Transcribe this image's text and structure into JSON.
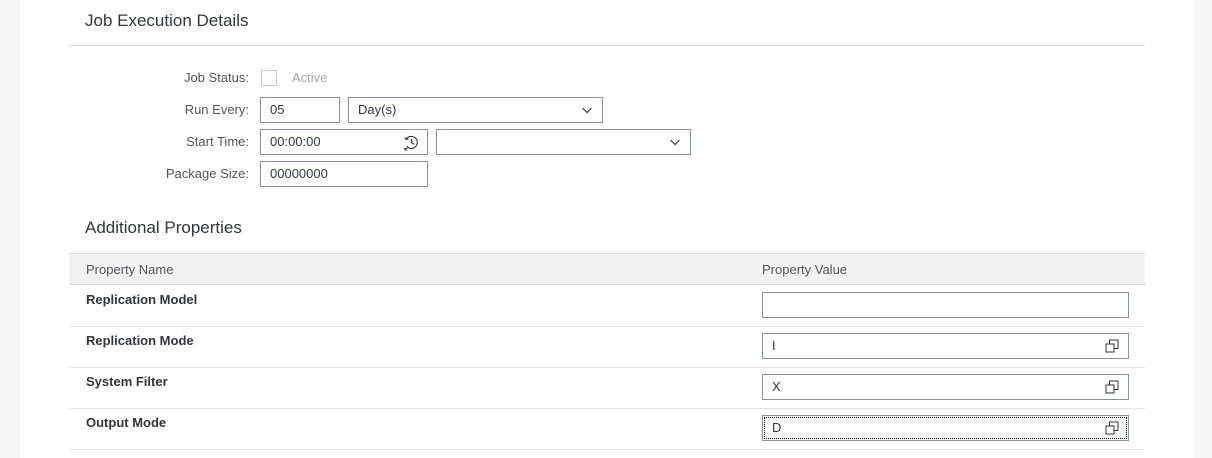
{
  "job_execution": {
    "title": "Job Execution Details",
    "job_status": {
      "label": "Job Status:",
      "checkbox_label": "Active",
      "checked": false
    },
    "run_every": {
      "label": "Run Every:",
      "value": "05",
      "unit": "Day(s)"
    },
    "start_time": {
      "label": "Start Time:",
      "value": "00:00:00",
      "timezone": ""
    },
    "package_size": {
      "label": "Package Size:",
      "value": "00000000"
    }
  },
  "additional_properties": {
    "title": "Additional Properties",
    "columns": [
      "Property Name",
      "Property Value"
    ],
    "rows": [
      {
        "name": "Replication Model",
        "value": ""
      },
      {
        "name": "Replication Mode",
        "value": "I"
      },
      {
        "name": "System Filter",
        "value": "X"
      },
      {
        "name": "Output Mode",
        "value": "D"
      }
    ]
  }
}
